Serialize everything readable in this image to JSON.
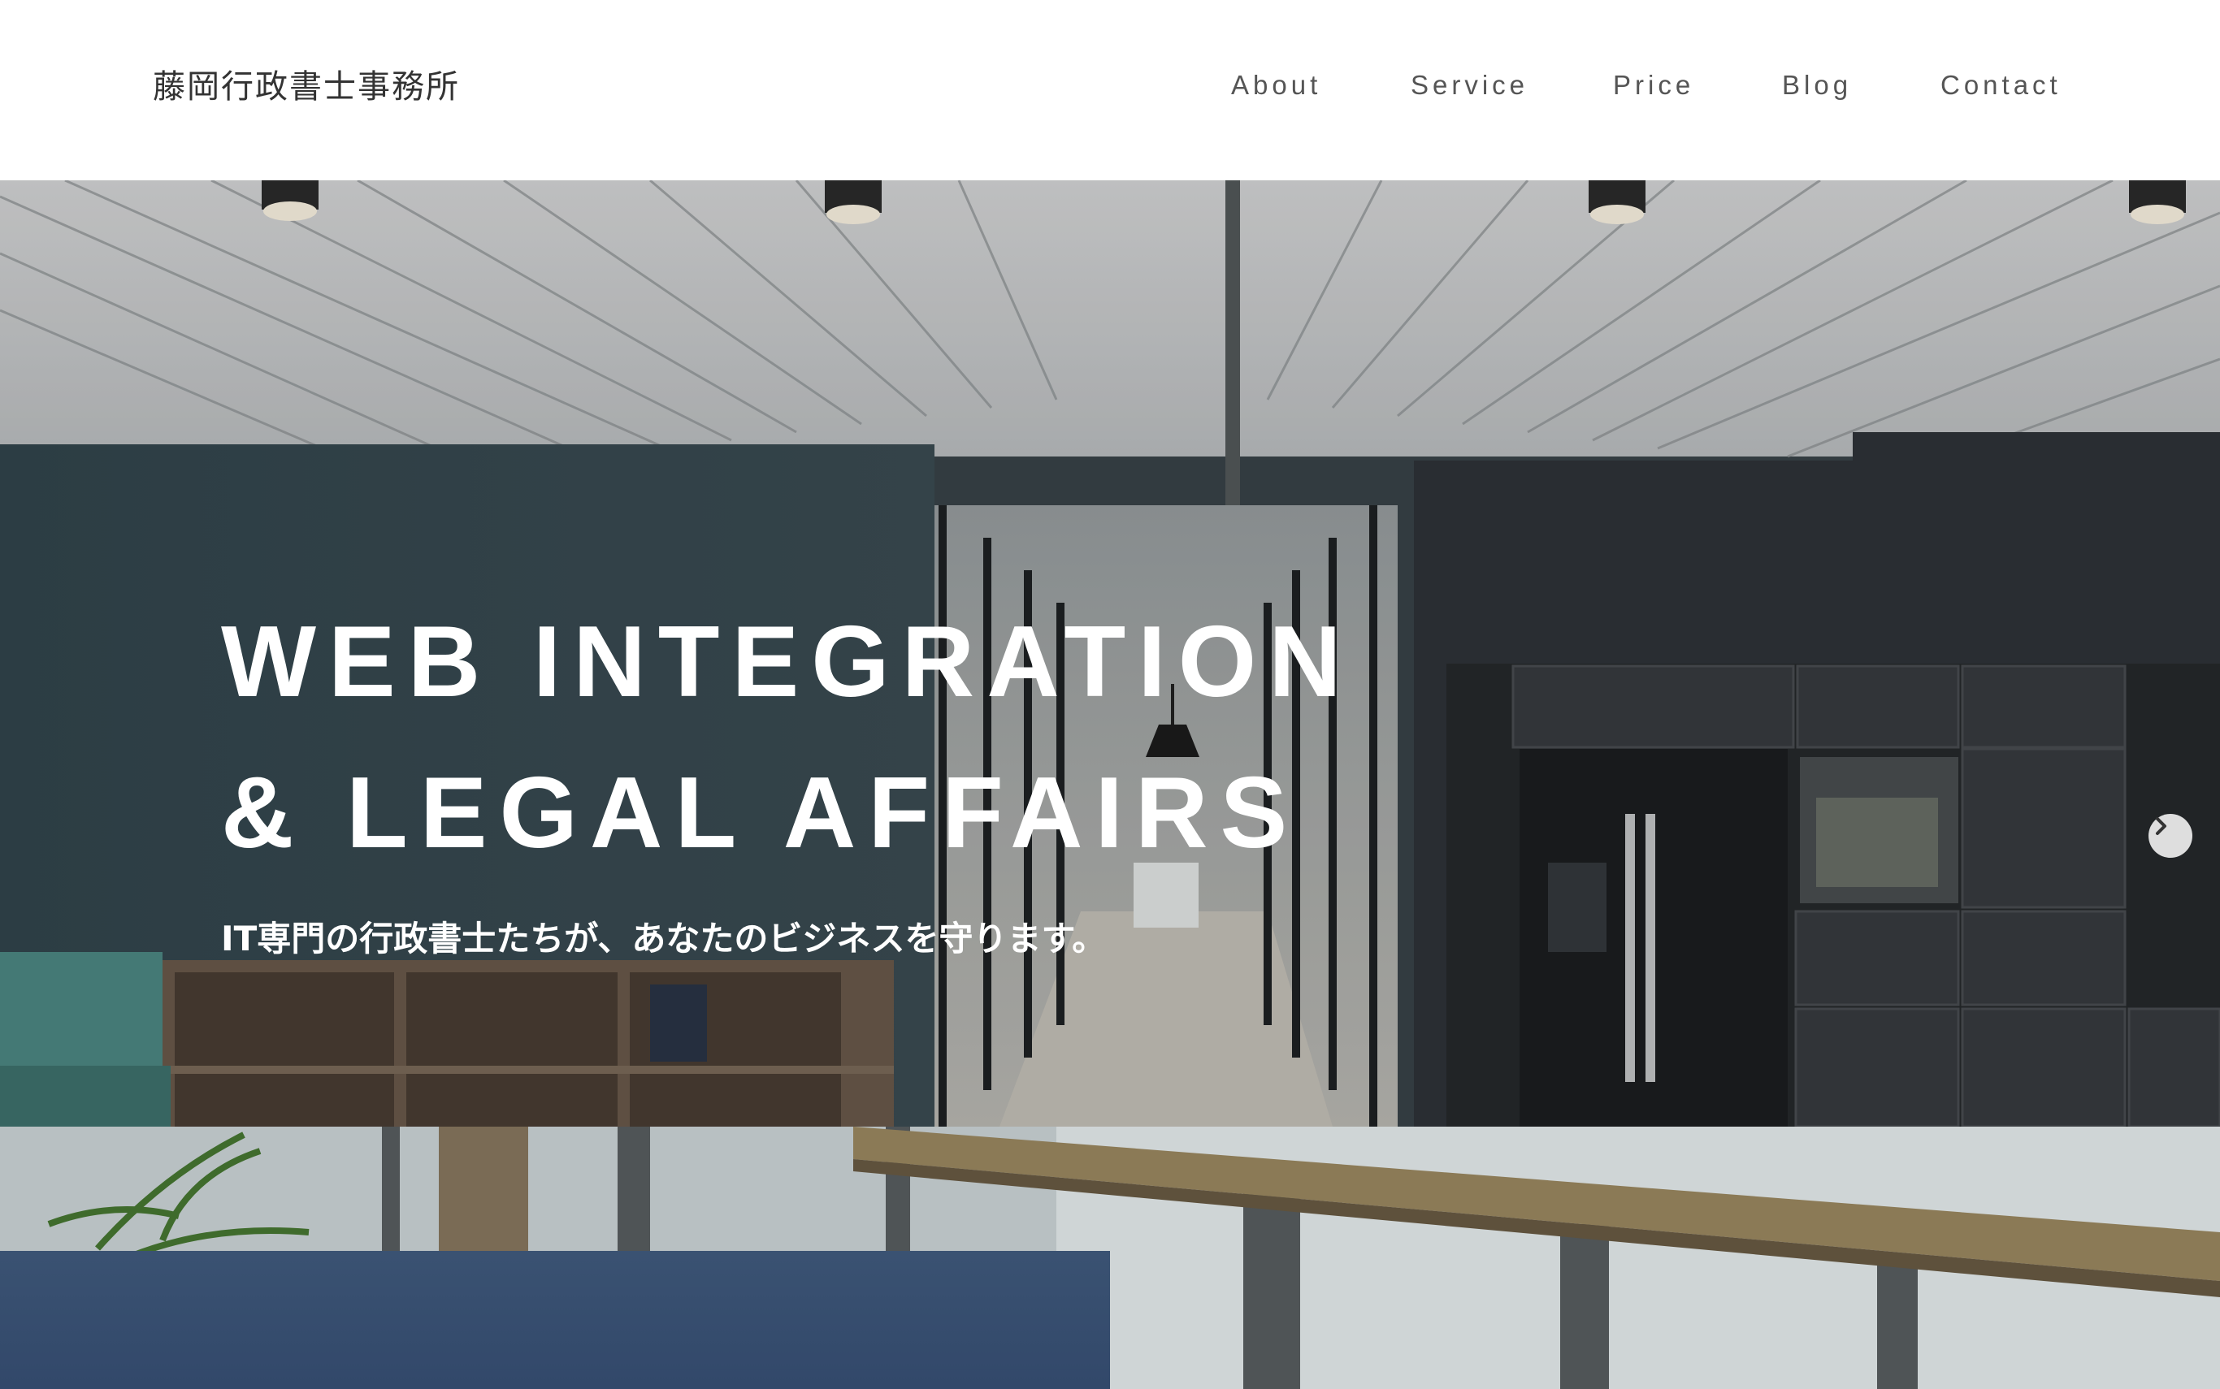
{
  "header": {
    "logo_text": "藤岡行政書士事務所",
    "nav": [
      {
        "label": "About"
      },
      {
        "label": "Service"
      },
      {
        "label": "Price"
      },
      {
        "label": "Blog"
      },
      {
        "label": "Contact"
      }
    ]
  },
  "hero": {
    "title_line1": "WEB INTEGRATION",
    "title_line2": "& LEGAL AFFAIRS",
    "subtitle": "IT専門の行政書士たちが、あなたのビジネスを守ります。",
    "next_icon": "chevron-right-icon"
  },
  "colors": {
    "nav_text": "#555555",
    "panel_blue": "#3a5272",
    "hero_text": "#ffffff"
  }
}
